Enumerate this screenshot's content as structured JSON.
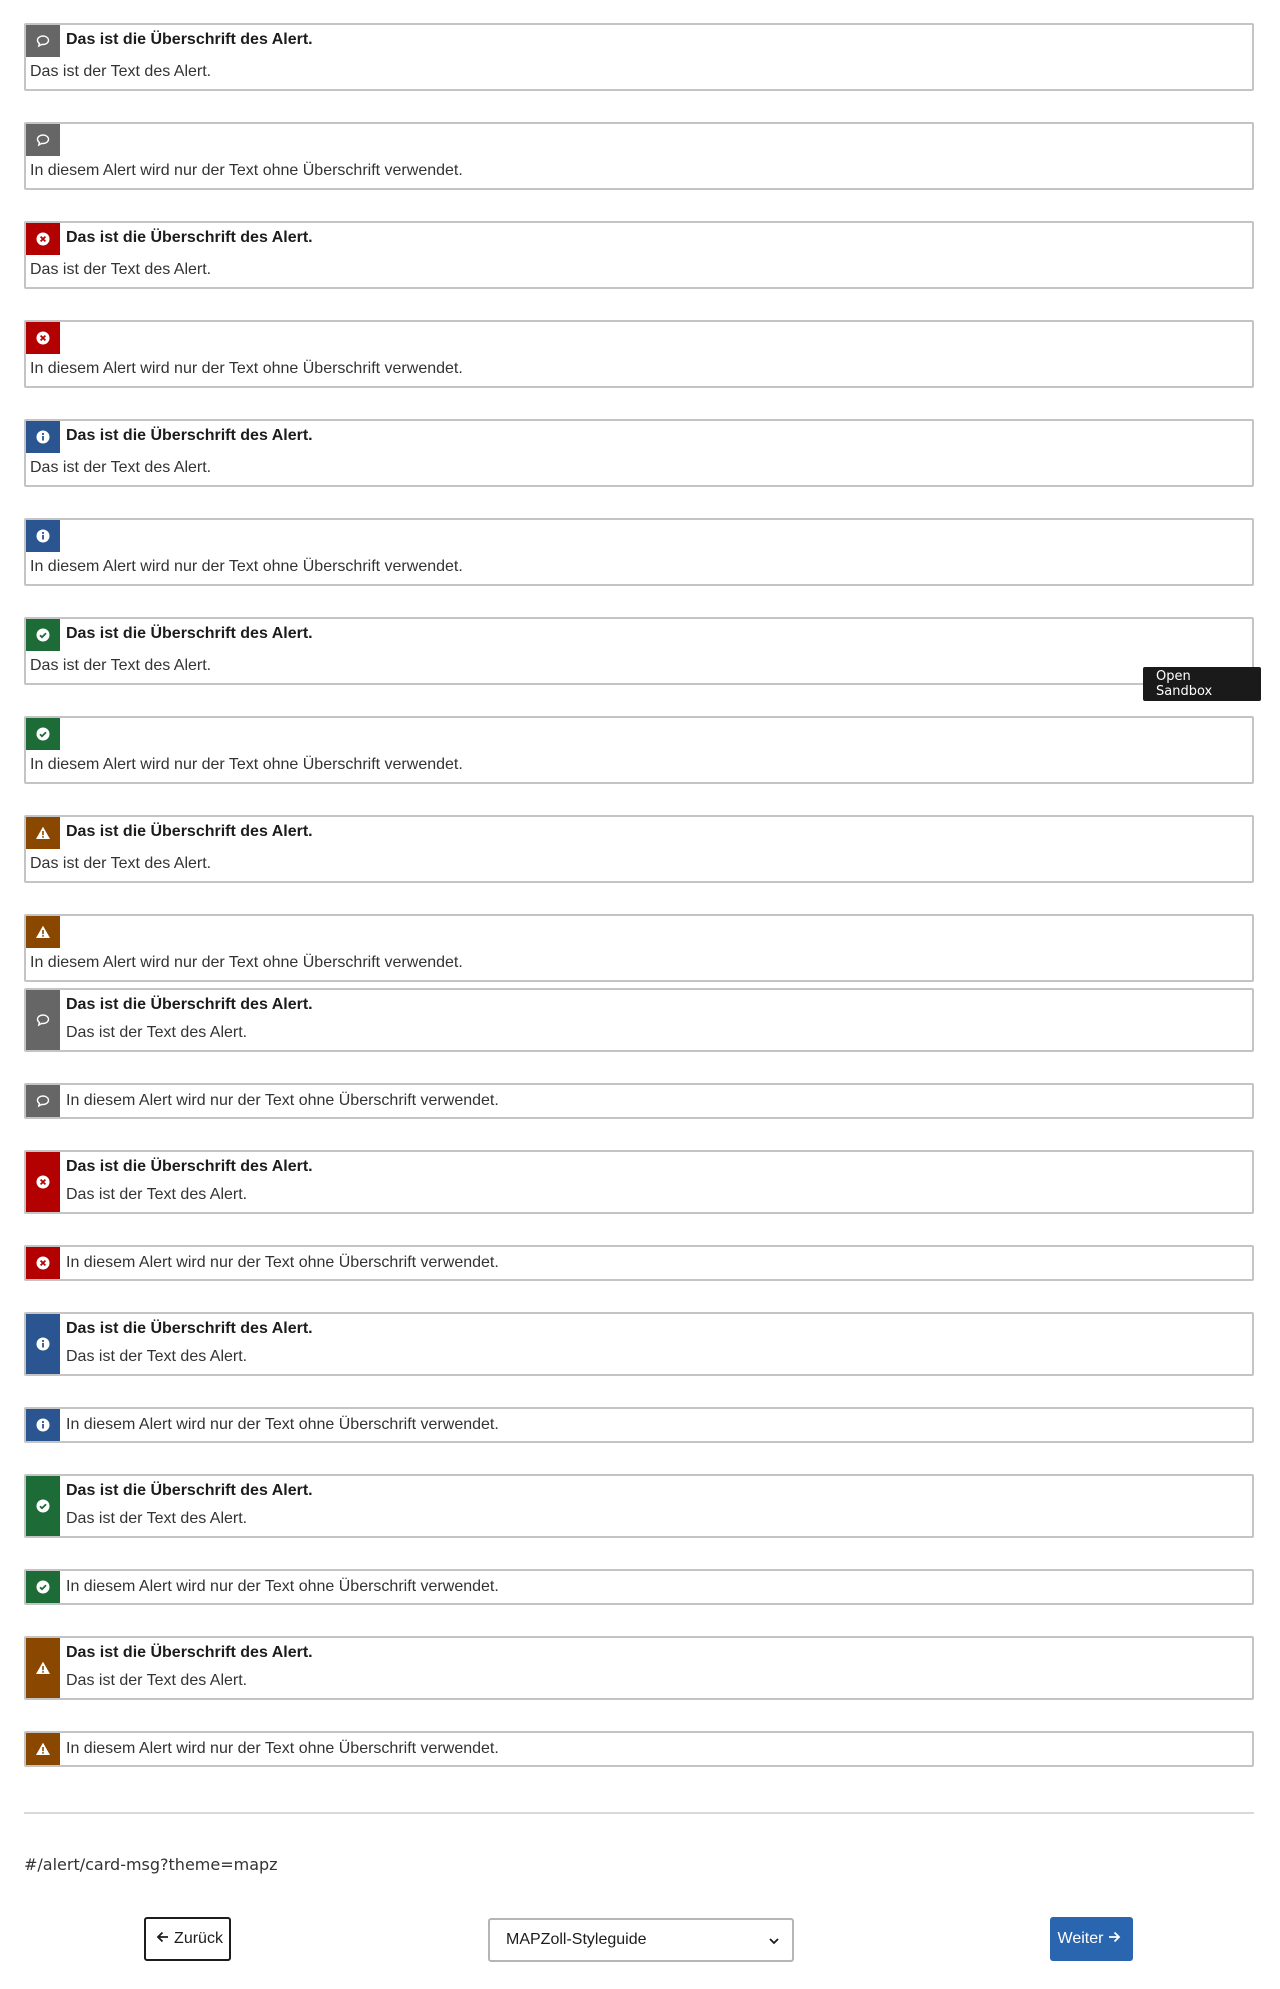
{
  "alert_title": "Das ist die Überschrift des Alert.",
  "alert_text": "Das ist der Text des Alert.",
  "alert_text_only": "In diesem Alert wird nur der Text ohne Überschrift verwendet.",
  "colors": {
    "neutral": "#666666",
    "error": "#b30000",
    "info": "#2a5591",
    "success": "#1d6b36",
    "warning": "#8a4700"
  },
  "icons": {
    "neutral": "speech-bubble-icon",
    "error": "error-x-circle-icon",
    "info": "info-circle-icon",
    "success": "check-circle-icon",
    "warning": "warning-triangle-icon"
  },
  "tooltip": {
    "line1": "Open",
    "line2": "Sandbox"
  },
  "route": "#/alert/card-msg?theme=mapz",
  "nav": {
    "back_label": "Zurück",
    "next_label": "Weiter",
    "select_value": "MAPZoll-Styleguide"
  }
}
